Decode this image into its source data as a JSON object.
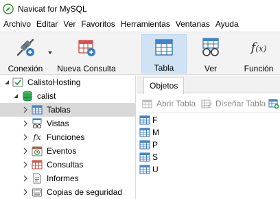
{
  "window": {
    "title": "Navicat for MySQL"
  },
  "menu": [
    "Archivo",
    "Editar",
    "Ver",
    "Favoritos",
    "Herramientas",
    "Ventanas",
    "Ayuda"
  ],
  "toolbar": {
    "connection_label": "Conexión",
    "new_query_label": "Nueva Consulta",
    "table_label": "Tabla",
    "view_label": "Ver",
    "function_label": "Función"
  },
  "tree": {
    "connection": "CalistoHosting",
    "database": "calist",
    "items": [
      "Tablas",
      "Vistas",
      "Funciones",
      "Eventos",
      "Consultas",
      "Informes",
      "Copias de seguridad"
    ],
    "selected": "Tablas"
  },
  "objects_panel": {
    "tab_label": "Objetos",
    "open_table_label": "Abrir Tabla",
    "design_table_label": "Diseñar Tabla",
    "tables": [
      "F",
      "M",
      "P",
      "S",
      "U"
    ]
  },
  "colors": {
    "accent_blue": "#2f7fd1",
    "selection_bg": "#d9d9d9",
    "active_tool_bg": "#cfe3f5",
    "db_green": "#2fa84f"
  }
}
